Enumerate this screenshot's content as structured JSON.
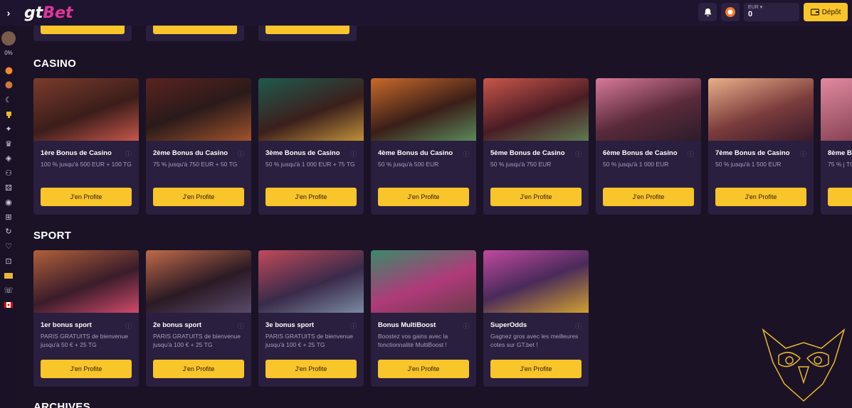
{
  "header": {
    "logo_gt": "gt",
    "logo_bet": "Bet",
    "balance_currency": "EUR ▾",
    "balance_amount": "0",
    "deposit_label": "Dépôt",
    "colors": {
      "accent": "#f8c52a",
      "brand": "#e0359a",
      "background": "#1b1226"
    }
  },
  "sidebar": {
    "progress": "0%",
    "icons": [
      "flame-icon",
      "basketball-icon",
      "moon-icon",
      "trophy-icon",
      "megaphone-icon",
      "crown-icon",
      "tag-icon",
      "bike-icon",
      "dice-icon",
      "ball-icon",
      "gift-icon",
      "spin-icon",
      "heart-icon",
      "grid-icon",
      "ticket-icon",
      "support-icon",
      "flag-icon"
    ]
  },
  "sections": {
    "casino": {
      "title": "CASINO",
      "cards": [
        {
          "title": "1ère Bonus de Casino",
          "desc": "100 % jusqu'à 500 EUR + 100 TG",
          "button": "J'en Profite"
        },
        {
          "title": "2ème Bonus du Casino",
          "desc": "75 % jusqu'à 750 EUR + 50 TG",
          "button": "J'en Profite"
        },
        {
          "title": "3ème Bonus de Casino",
          "desc": "50 % jusqu'à 1 000 EUR + 75 TG",
          "button": "J'en Profite"
        },
        {
          "title": "4ème Bonus du Casino",
          "desc": "50 % jusqu'à 500 EUR",
          "button": "J'en Profite"
        },
        {
          "title": "5ème Bonus de Casino",
          "desc": "50 % jusqu'à 750 EUR",
          "button": "J'en Profite"
        },
        {
          "title": "6ème Bonus de Casino",
          "desc": "50 % jusqu'à 1 000 EUR",
          "button": "J'en Profite"
        },
        {
          "title": "7ème Bonus de Casino",
          "desc": "50 % jusqu'à 1 500 EUR",
          "button": "J'en Profite"
        },
        {
          "title": "8ème B",
          "desc": "75 % j TG",
          "button": ""
        }
      ]
    },
    "sport": {
      "title": "SPORT",
      "cards": [
        {
          "title": "1er bonus sport",
          "desc": "PARIS GRATUITS de bienvenue jusqu'à 50 € + 25 TG",
          "button": "J'en Profite"
        },
        {
          "title": "2e bonus sport",
          "desc": "PARIS GRATUITS de bienvenue jusqu'à 100 € + 25 TG",
          "button": "J'en Profite"
        },
        {
          "title": "3e bonus sport",
          "desc": "PARIS GRATUITS de bienvenue jusqu'à 100 € + 25 TG",
          "button": "J'en Profite"
        },
        {
          "title": "Bonus MultiBoost",
          "desc": "Boostez vos gains avec la fonctionnalité MultiBoost !",
          "button": "J'en Profite"
        },
        {
          "title": "SuperOdds",
          "desc": "Gagnez gros avec les meilleures cotes sur GT.bet !",
          "button": "J'en Profite"
        }
      ]
    },
    "archives": {
      "title": "ARCHIVES"
    }
  }
}
